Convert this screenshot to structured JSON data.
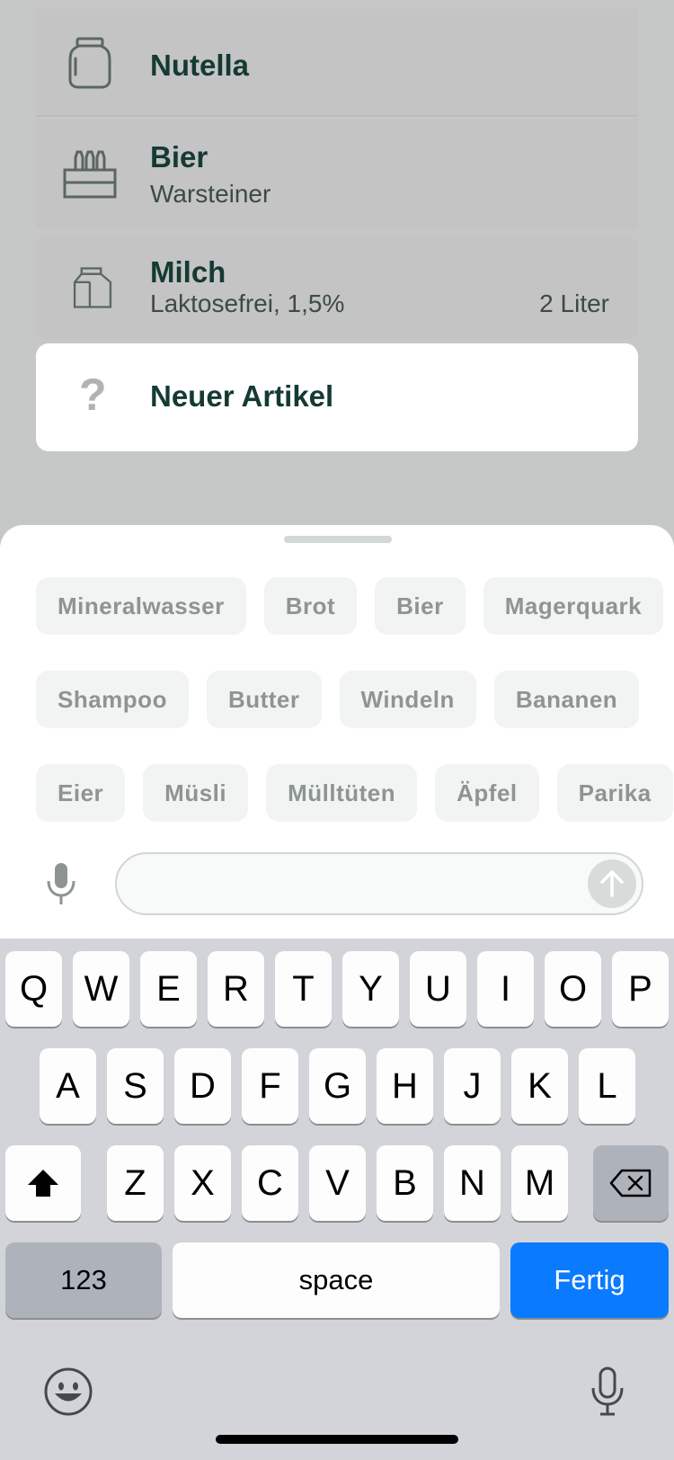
{
  "list": {
    "items": [
      {
        "icon": "jar-icon",
        "title": "Nutella",
        "subtitle": "",
        "quantity": ""
      },
      {
        "icon": "beer-crate-icon",
        "title": "Bier",
        "subtitle": "Warsteiner",
        "quantity": ""
      },
      {
        "icon": "milk-carton-icon",
        "title": "Milch",
        "subtitle": "Laktosefrei, 1,5%",
        "quantity": "2 Liter"
      }
    ],
    "new_item": {
      "icon": "question-icon",
      "glyph": "?",
      "title": "Neuer Artikel"
    }
  },
  "suggestions": {
    "row1": [
      "Mineralwasser",
      "Brot",
      "Bier",
      "Magerquark"
    ],
    "row2": [
      "Shampoo",
      "Butter",
      "Windeln",
      "Bananen"
    ],
    "row3": [
      "Eier",
      "Müsli",
      "Mülltüten",
      "Äpfel",
      "Parika"
    ]
  },
  "input": {
    "value": "",
    "placeholder": ""
  },
  "keyboard": {
    "row1": [
      "Q",
      "W",
      "E",
      "R",
      "T",
      "Y",
      "U",
      "I",
      "O",
      "P"
    ],
    "row2": [
      "A",
      "S",
      "D",
      "F",
      "G",
      "H",
      "J",
      "K",
      "L"
    ],
    "row3": [
      "Z",
      "X",
      "C",
      "V",
      "B",
      "N",
      "M"
    ],
    "numbers_label": "123",
    "space_label": "space",
    "done_label": "Fertig"
  },
  "colors": {
    "accent": "#0A7AFF",
    "title_text": "#143A33",
    "chip_bg": "#F2F4F3"
  }
}
